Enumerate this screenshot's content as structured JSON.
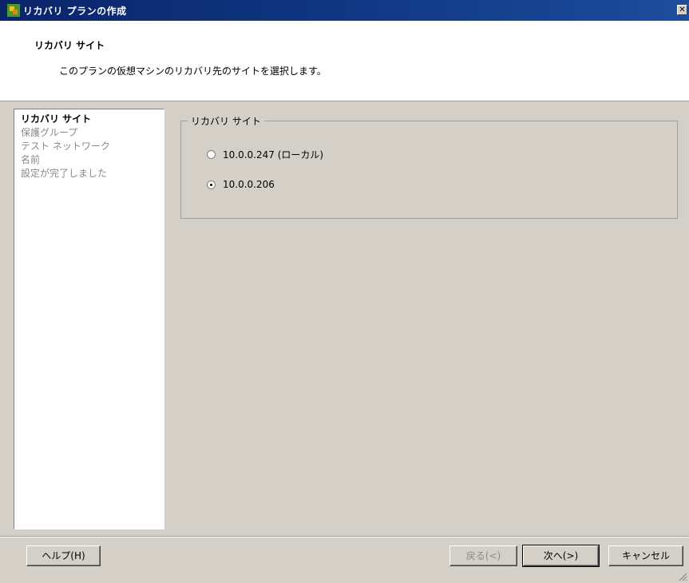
{
  "window": {
    "title": "リカバリ プランの作成",
    "close_glyph": "✕"
  },
  "header": {
    "title": "リカバリ サイト",
    "description": "このプランの仮想マシンのリカバリ先のサイトを選択します。"
  },
  "steps": [
    {
      "label": "リカバリ サイト",
      "active": true
    },
    {
      "label": "保護グループ",
      "active": false
    },
    {
      "label": "テスト ネットワーク",
      "active": false
    },
    {
      "label": "名前",
      "active": false
    },
    {
      "label": "設定が完了しました",
      "active": false
    }
  ],
  "site_group": {
    "legend": "リカバリ サイト",
    "options": [
      {
        "label": "10.0.0.247 (ローカル)",
        "selected": false
      },
      {
        "label": "10.0.0.206",
        "selected": true
      }
    ]
  },
  "buttons": {
    "help": "ヘルプ(H)",
    "back": "戻る(<)",
    "next": "次へ(>)",
    "cancel": "キャンセル"
  }
}
